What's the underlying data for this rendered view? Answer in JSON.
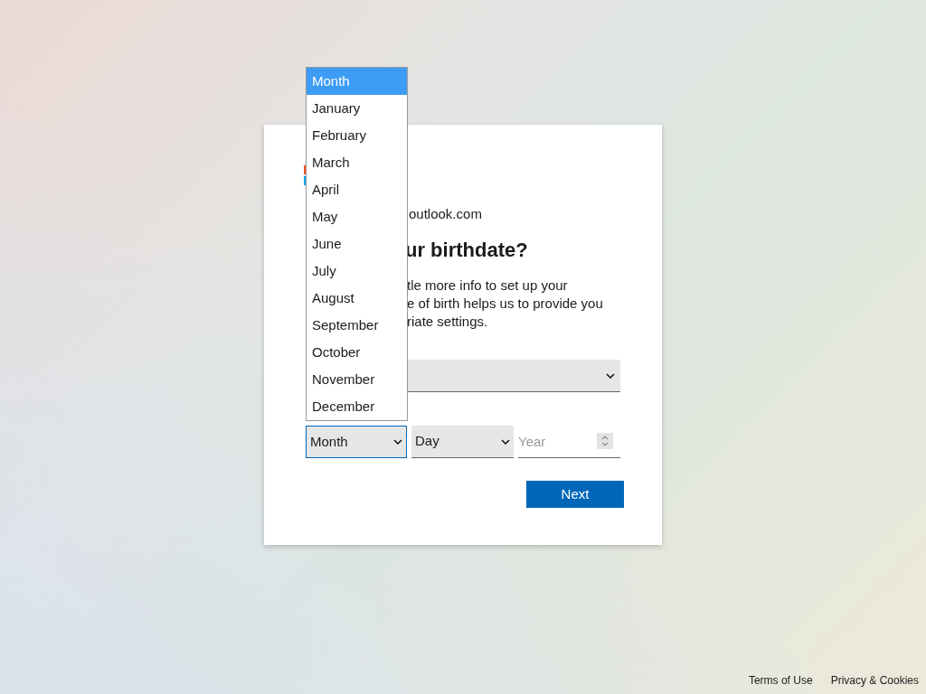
{
  "card": {
    "email": "outlook.com",
    "heading": "ur birthdate?",
    "description_lines": [
      "tle more info to set up your",
      "e of birth helps us to provide you",
      "riate settings."
    ],
    "birthdate": {
      "month": {
        "value": "Month",
        "open": true,
        "focused": true
      },
      "day": {
        "value": "Day"
      },
      "year": {
        "placeholder": "Year"
      }
    },
    "next_button": "Next"
  },
  "month_options": [
    {
      "label": "Month",
      "selected": true
    },
    {
      "label": "January",
      "selected": false
    },
    {
      "label": "February",
      "selected": false
    },
    {
      "label": "March",
      "selected": false
    },
    {
      "label": "April",
      "selected": false
    },
    {
      "label": "May",
      "selected": false
    },
    {
      "label": "June",
      "selected": false
    },
    {
      "label": "July",
      "selected": false
    },
    {
      "label": "August",
      "selected": false
    },
    {
      "label": "September",
      "selected": false
    },
    {
      "label": "October",
      "selected": false
    },
    {
      "label": "November",
      "selected": false
    },
    {
      "label": "December",
      "selected": false
    }
  ],
  "footer_links": [
    "Terms of Use",
    "Privacy & Cookies"
  ]
}
